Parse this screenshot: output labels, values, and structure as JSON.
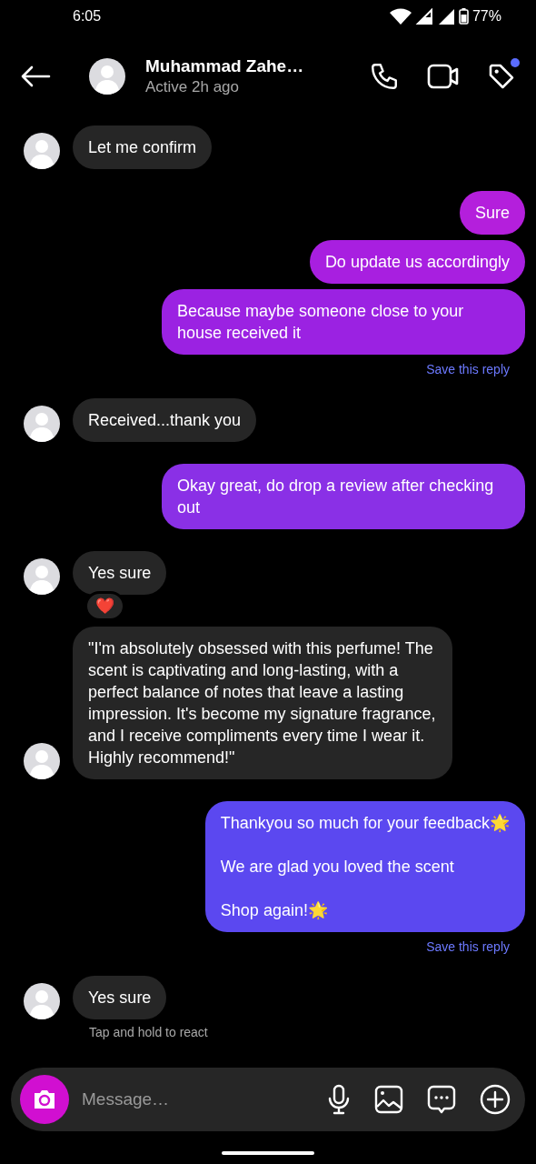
{
  "status_bar": {
    "time": "6:05",
    "battery": "77%"
  },
  "header": {
    "name": "Muhammad Zahe…",
    "status": "Active 2h ago",
    "notification_dot": true
  },
  "messages": [
    {
      "kind": "incoming",
      "text": "Let me confirm"
    },
    {
      "kind": "outgoing",
      "text": "Sure",
      "color": "#b41fdc"
    },
    {
      "kind": "outgoing",
      "text": "Do update us accordingly",
      "color": "#a81fe0"
    },
    {
      "kind": "outgoing",
      "text": "Because maybe someone close to your house received it",
      "color": "#9b22e2",
      "save": "Save this reply"
    },
    {
      "kind": "incoming",
      "text": "Received...thank you"
    },
    {
      "kind": "outgoing",
      "text": "Okay great, do drop a review after checking out",
      "color": "#8a30e6"
    },
    {
      "kind": "incoming",
      "text": "Yes sure",
      "reaction": "❤️"
    },
    {
      "kind": "incoming",
      "text": "\"I'm absolutely obsessed with this perfume! The scent is captivating and long-lasting, with a perfect balance of notes that leave a lasting impression. It's become my signature fragrance, and I receive compliments every time I wear it. Highly recommend!\""
    },
    {
      "kind": "outgoing",
      "lines": [
        "Thankyou so much for your feedback🌟",
        "We are glad you loved the scent",
        "Shop again!🌟"
      ],
      "color": "#5b48f0",
      "save": "Save this reply"
    },
    {
      "kind": "incoming",
      "text": "Yes sure",
      "hint": "Tap and hold to react"
    }
  ],
  "composer": {
    "placeholder": "Message…"
  }
}
